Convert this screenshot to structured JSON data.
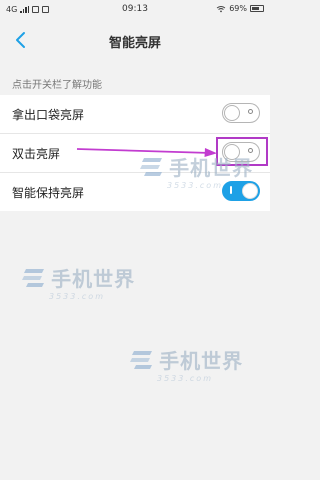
{
  "status_bar": {
    "network": "4G",
    "time": "09:13",
    "battery": "69%"
  },
  "header": {
    "title": "智能亮屏"
  },
  "section_hint": "点击开关栏了解功能",
  "settings": [
    {
      "label": "拿出口袋亮屏",
      "on": false
    },
    {
      "label": "双击亮屏",
      "on": false
    },
    {
      "label": "智能保持亮屏",
      "on": true
    }
  ],
  "watermark": {
    "brand": "手机世界",
    "site": "3533.com"
  },
  "colors": {
    "toggle_on": "#1ea1e6",
    "highlight": "#b13ac6",
    "background": "#f2f2f2"
  }
}
